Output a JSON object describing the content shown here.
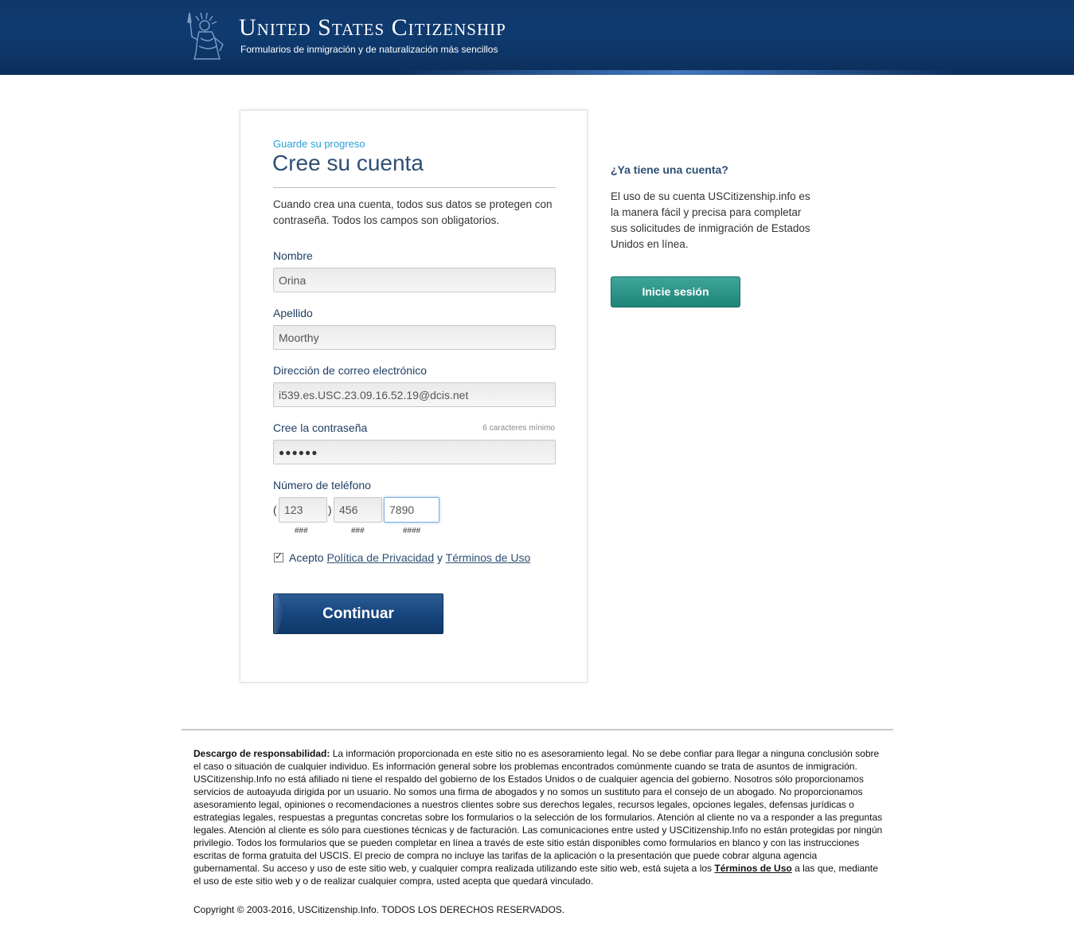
{
  "header": {
    "title": "United States Citizenship",
    "subtitle": "Formularios de inmigración y de naturalización más sencillos"
  },
  "form": {
    "eyebrow": "Guarde su progreso",
    "title": "Cree su cuenta",
    "intro": "Cuando crea una cuenta, todos sus datos se protegen con contraseña. Todos los campos son obligatorios.",
    "first_name": {
      "label": "Nombre",
      "value": "Orina"
    },
    "last_name": {
      "label": "Apellido",
      "value": "Moorthy"
    },
    "email": {
      "label": "Dirección de correo electrónico",
      "value": "i539.es.USC.23.09.16.52.19@dcis.net"
    },
    "password": {
      "label": "Cree la contraseña",
      "hint": "6 caracteres mínimo",
      "value": "●●●●●●"
    },
    "phone": {
      "label": "Número de teléfono",
      "open_paren": "(",
      "close_paren": ")",
      "area": {
        "value": "123",
        "hint": "###"
      },
      "prefix": {
        "value": "456",
        "hint": "###"
      },
      "line": {
        "value": "7890",
        "hint": "####"
      }
    },
    "terms": {
      "checked": true,
      "prefix": "Acepto",
      "privacy_link": "Política de Privacidad",
      "joiner": "y",
      "terms_link": "Términos de Uso"
    },
    "submit_label": "Continuar"
  },
  "side": {
    "title": "¿Ya tiene una cuenta?",
    "text": "El uso de su cuenta USCitizenship.info es la manera fácil y precisa para completar sus solicitudes de inmigración de Estados Unidos en línea.",
    "login_label": "Inicie sesión"
  },
  "footer": {
    "disclaimer_label": "Descargo de responsabilidad:",
    "disclaimer_text": "La información proporcionada en este sitio no es asesoramiento legal. No se debe confiar para llegar a ninguna conclusión sobre el caso o situación de cualquier individuo. Es información general sobre los problemas encontrados comúnmente cuando se trata de asuntos de inmigración. USCitizenship.Info no está afiliado ni tiene el respaldo del gobierno de los Estados Unidos o de cualquier agencia del gobierno. Nosotros sólo proporcionamos servicios de autoayuda dirigida por un usuario. No somos una firma de abogados y no somos un sustituto para el consejo de un abogado. No proporcionamos asesoramiento legal, opiniones o recomendaciones a nuestros clientes sobre sus derechos legales, recursos legales, opciones legales, defensas jurídicas o estrategias legales, respuestas a preguntas concretas sobre los formularios o la selección de los formularios. Atención al cliente no va a responder a las preguntas legales. Atención al cliente es sólo para cuestiones técnicas y de facturación. Las comunicaciones entre usted y USCitizenship.Info no están protegidas por ningún privilegio. Todos los formularios que se pueden completar en línea a través de este sitio están disponibles como formularios en blanco y con las instrucciones escritas de forma gratuita del USCIS. El precio de compra no incluye las tarifas de la aplicación o la presentación que puede cobrar alguna agencia gubernamental. Su acceso y uso de este sitio web, y cualquier compra realizada utilizando este sitio web, está sujeta a los",
    "terms_link": "Términos de Uso",
    "disclaimer_tail": "a las que, mediante el uso de este sitio web y o de realizar cualquier compra, usted acepta que quedará vinculado.",
    "copyright": "Copyright © 2003-2016, USCitizenship.Info. TODOS LOS DERECHOS RESERVADOS."
  }
}
